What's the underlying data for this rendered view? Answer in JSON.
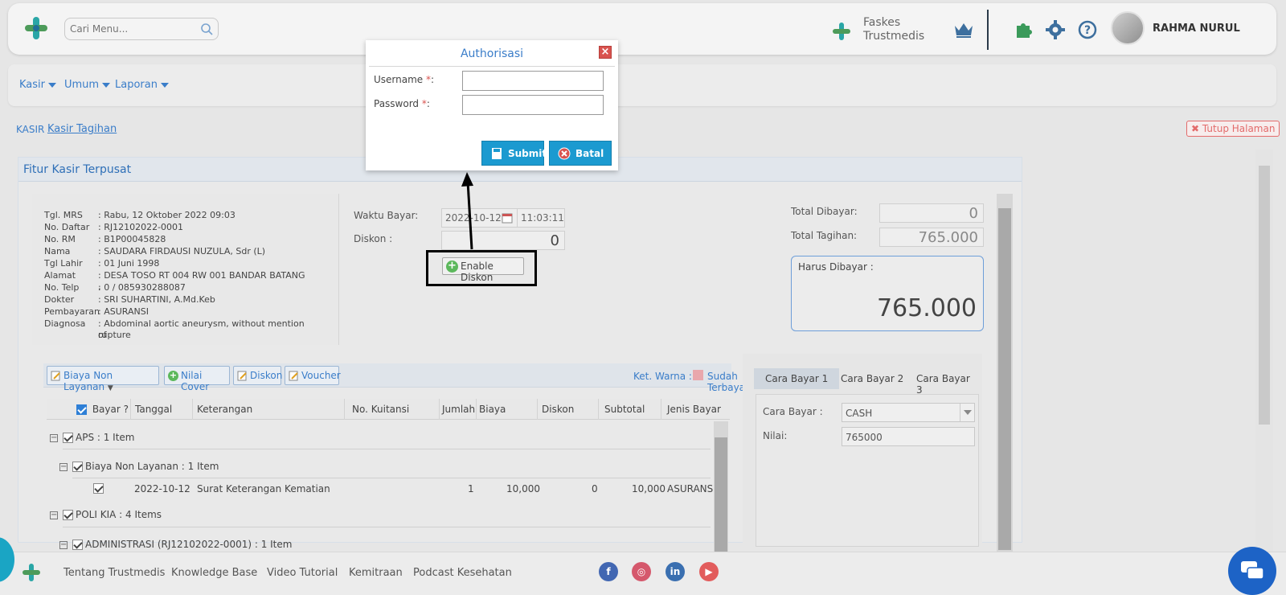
{
  "header": {
    "search_placeholder": "Cari Menu...",
    "faskes_line1": "Faskes",
    "faskes_line2": "Trustmedis",
    "user_name": "RAHMA NURUL"
  },
  "nav": {
    "items": [
      {
        "label": "Kasir"
      },
      {
        "label": "Umum"
      },
      {
        "label": "Laporan"
      }
    ]
  },
  "breadcrumb": {
    "root": "KASIR",
    "current": "Kasir Tagihan",
    "close_label": "Tutup Halaman"
  },
  "panel": {
    "title": "Fitur Kasir Terpusat"
  },
  "patient": {
    "rows": [
      {
        "label": "Tgl. MRS",
        "value": ": Rabu, 12 Oktober 2022 09:03"
      },
      {
        "label": "No. Daftar",
        "value": ": RJ12102022-0001"
      },
      {
        "label": "No. RM",
        "value": ": B1P00045828"
      },
      {
        "label": "Nama",
        "value": ": SAUDARA FIRDAUSI NUZULA, Sdr (L)"
      },
      {
        "label": "Tgl Lahir",
        "value": ": 01 Juni 1998"
      },
      {
        "label": "Alamat",
        "value": ": DESA TOSO RT 004 RW 001 BANDAR BATANG ,"
      },
      {
        "label": "No. Telp",
        "value": ": 0 / 085930288087"
      },
      {
        "label": "Dokter",
        "value": ": SRI SUHARTINI, A.Md.Keb"
      },
      {
        "label": "Pembayaran",
        "value": ": ASURANSI"
      },
      {
        "label": "Diagnosa",
        "value": ": Abdominal aortic aneurysm, without mention of"
      },
      {
        "label": "",
        "value": "  rupture"
      }
    ]
  },
  "payment": {
    "waktu_label": "Waktu Bayar:",
    "date_value": "2022-10-12",
    "time_value": "11:03:11",
    "diskon_label": "Diskon :",
    "diskon_value": "0",
    "enable_diskon_label": "Enable Diskon",
    "total_dibayar_label": "Total Dibayar:",
    "total_dibayar_value": "0",
    "total_tagihan_label": "Total Tagihan:",
    "total_tagihan_value": "765.000",
    "harus_label": "Harus Dibayar :",
    "harus_value": "765.000"
  },
  "toolbar": {
    "biaya_non_layanan": "Biaya Non Layanan",
    "nilai_cover": "Nilai Cover",
    "diskon": "Diskon",
    "voucher": "Voucher",
    "ket_warna": "Ket. Warna :",
    "sudah_terbayar": "Sudah Terbayar",
    "sudah_color": "#e9a7ac"
  },
  "table": {
    "headers": [
      "Bayar ?",
      "Tanggal",
      "Keterangan",
      "No. Kuitansi",
      "Jumlah",
      "Biaya",
      "Diskon",
      "Subtotal",
      "Jenis Bayar"
    ],
    "group1": "APS : 1 Item",
    "subgroup1": "Biaya Non Layanan : 1 Item",
    "row1": {
      "tanggal": "2022-10-12",
      "keterangan": "Surat Keterangan Kematian",
      "jumlah": "1",
      "biaya": "10,000",
      "diskon": "0",
      "subtotal": "10,000",
      "jenis": "ASURANSI"
    },
    "group2": "POLI KIA : 4 Items",
    "subgroup2": "ADMINISTRASI (RJ12102022-0001) : 1 Item"
  },
  "cara_bayar": {
    "tabs": [
      "Cara Bayar 1",
      "Cara Bayar 2",
      "Cara Bayar 3"
    ],
    "cara_label": "Cara Bayar :",
    "cara_value": "CASH",
    "nilai_label": "Nilai:",
    "nilai_value": "765000"
  },
  "footer": {
    "links": [
      "Tentang Trustmedis",
      "Knowledge Base",
      "Video Tutorial",
      "Kemitraan",
      "Podcast Kesehatan"
    ]
  },
  "modal": {
    "title": "Authorisasi",
    "username_label": "Username",
    "password_label": "Password",
    "required_mark": "*",
    "colon": ":",
    "submit_label": "Submit",
    "cancel_label": "Batal"
  },
  "colors": {
    "accent": "#3a7dc9",
    "brand_teal": "#1b9ad0",
    "danger": "#d9534f"
  }
}
